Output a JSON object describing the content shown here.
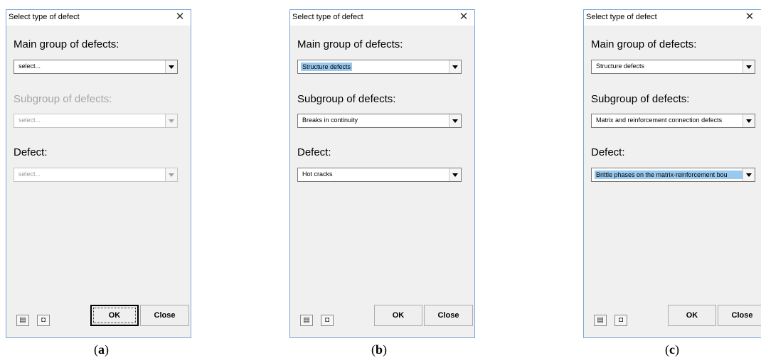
{
  "dialogs": [
    {
      "title": "Select type of defect",
      "main_group_label": "Main group of defects:",
      "main_group_value": "select...",
      "subgroup_label": "Subgroup of defects:",
      "subgroup_value": "select...",
      "defect_label": "Defect:",
      "defect_value": "select...",
      "ok_label": "OK",
      "close_label": "Close",
      "caption_letter": "a"
    },
    {
      "title": "Select type of defect",
      "main_group_label": "Main group of defects:",
      "main_group_value": "Structure defects",
      "subgroup_label": "Subgroup of defects:",
      "subgroup_value": "Breaks in continuity",
      "defect_label": "Defect:",
      "defect_value": "Hot cracks",
      "ok_label": "OK",
      "close_label": "Close",
      "caption_letter": "b"
    },
    {
      "title": "Select type of defect",
      "main_group_label": "Main group of defects:",
      "main_group_value": "Structure defects",
      "subgroup_label": "Subgroup of defects:",
      "subgroup_value": "Matrix and reinforcement connection defects",
      "defect_label": "Defect:",
      "defect_value": "Brittle phases on the matrix-reinforcement bou",
      "ok_label": "OK",
      "close_label": "Close",
      "caption_letter": "c"
    }
  ],
  "icons": {
    "close": "close-icon",
    "list": "list-icon",
    "image": "image-icon",
    "dropdown": "chevron-down-icon"
  },
  "colors": {
    "dialog_bg": "#f0f0f0",
    "border": "#7aa7d8",
    "selection": "#99c9ef",
    "disabled_text": "#a5a5a5"
  }
}
